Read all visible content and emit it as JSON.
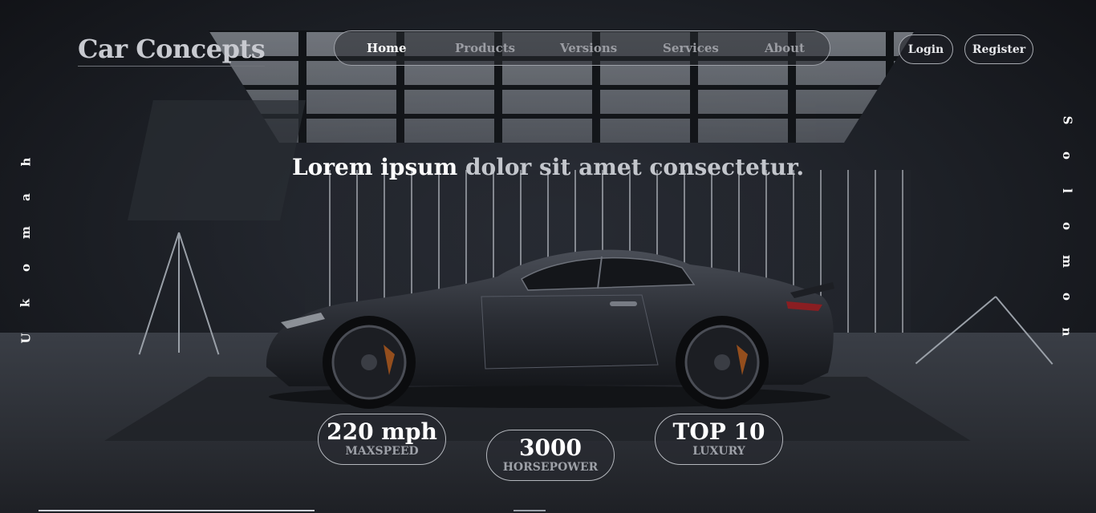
{
  "brand": {
    "logo": "Car Concepts"
  },
  "nav": {
    "items": [
      {
        "label": "Home",
        "active": true
      },
      {
        "label": "Products",
        "active": false
      },
      {
        "label": "Versions",
        "active": false
      },
      {
        "label": "Services",
        "active": false
      },
      {
        "label": "About",
        "active": false
      }
    ]
  },
  "auth": {
    "login": "Login",
    "register": "Register"
  },
  "hero": {
    "headline_strong": "Lorem ipsum",
    "headline_soft": "dolor sit amet consectetur."
  },
  "side_text": {
    "left": "Ukomah",
    "right": "Solomon"
  },
  "stats": [
    {
      "value": "220 mph",
      "label": "MAXSPEED"
    },
    {
      "value": "3000",
      "label": "HORSEPOWER"
    },
    {
      "value": "TOP 10",
      "label": "LUXURY"
    }
  ],
  "colors": {
    "accent": "#ffffff",
    "muted": "#9ea1a8",
    "background": "#1b1d22"
  }
}
